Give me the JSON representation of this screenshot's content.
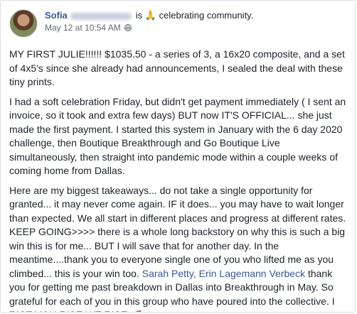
{
  "post": {
    "author": "Sofia",
    "verb": "is",
    "activity_emoji": "🙏",
    "activity": "celebrating community.",
    "timestamp": "May 12 at 10:54 AM",
    "paragraphs": {
      "p1": "MY FIRST JULIE!!!!!! $1035.50 - a series of 3, a 16x20 composite, and a set of 4x5's since she already had announcements, I sealed the deal with these tiny prints.",
      "p2": "I had a soft celebration Friday, but didn't get payment immediately ( I sent an invoice, so it took and extra few days) BUT now IT'S OFFICIAL... she just made the first payment. I started this system in January with the 6 day 2020 challenge, then Boutique Breakthrough and Go Boutique Live simultaneously, then straight into pandemic mode within a couple weeks of coming home from Dallas.",
      "p3_before": "Here are my biggest takeaways... do not take a single opportunity for granted... it may never come again. IF it does... you may have to wait longer than expected. We all start in different places and progress at different rates. KEEP GOING>>>> there is a whole long backstory on why this is such a big win this is for me... BUT I will save that for another day. In the meantime....thank you to everyone single one of you who lifted me as you climbed... this is your win too. ",
      "p3_link": "Sarah Petty, Erin Lagemann Verbeck",
      "p3_after": " thank you for getting me past breakdown in Dallas into Breakthrough in May. So grateful for each of you in this group who have poured into the collective. I RISE YOU RISE WE RISE ",
      "p3_emoji": "💕"
    }
  }
}
